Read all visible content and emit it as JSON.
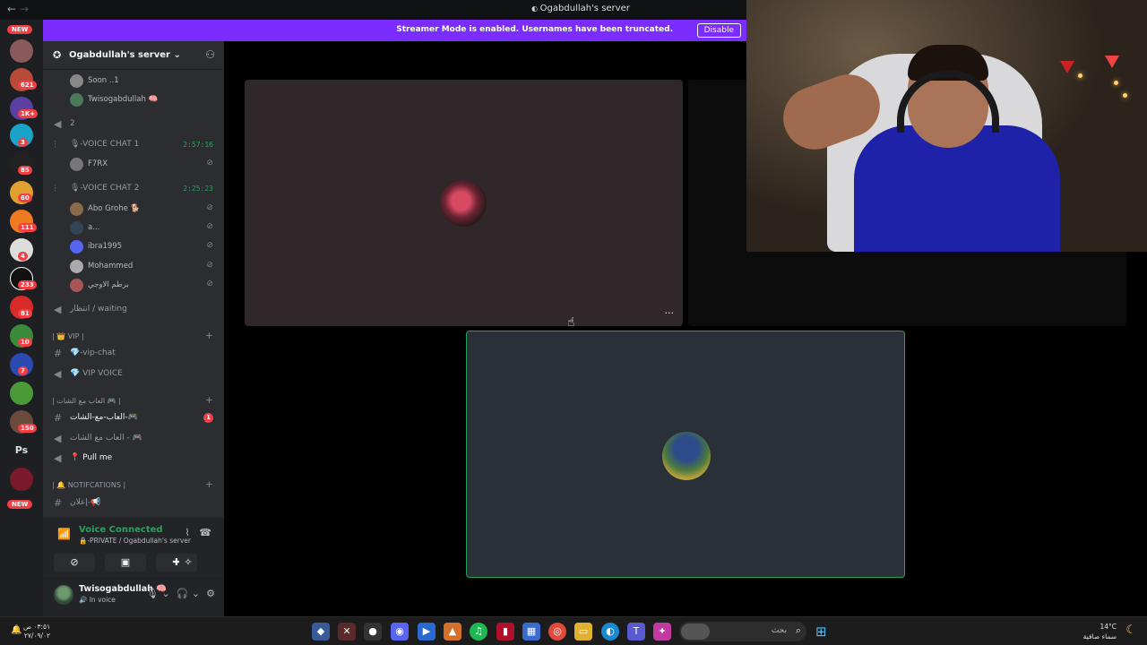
{
  "window": {
    "title": "Ogabdullah's server",
    "nav_back": "←",
    "nav_fwd": "→"
  },
  "banner": {
    "message": "Streamer Mode is enabled. Usernames have been truncated.",
    "button": "Disable",
    "color": "#7b2cff"
  },
  "server_rail": {
    "new_top": "NEW",
    "new_bottom": "NEW",
    "ps_label": "Ps",
    "badges": [
      "621",
      "1K+",
      "3",
      "85",
      "60",
      "111",
      "4",
      "233",
      "81",
      "10",
      "7",
      "150"
    ]
  },
  "sidebar": {
    "server_name": "Ogabdullah's server",
    "chevron": "⌄",
    "items": [
      {
        "kind": "user",
        "label": "Soon ..1"
      },
      {
        "kind": "user-hi",
        "label": "Twisogabdullah 🧠"
      },
      {
        "kind": "voice",
        "label": "2"
      },
      {
        "kind": "voice-live",
        "label": "🎙-VOICE CHAT 1",
        "timer": "2:57:16"
      },
      {
        "kind": "user",
        "label": "F7RX"
      },
      {
        "kind": "voice-live",
        "label": "🎙-VOICE CHAT 2",
        "timer": "2:25:23"
      },
      {
        "kind": "user",
        "label": "Abo Grohe 🐕"
      },
      {
        "kind": "user",
        "label": "a..."
      },
      {
        "kind": "user",
        "label": "ibra1995"
      },
      {
        "kind": "user",
        "label": "Mohammed"
      },
      {
        "kind": "user",
        "label": "برطم الاوجي"
      },
      {
        "kind": "voice",
        "label": "انتظار / waiting"
      },
      {
        "kind": "category",
        "label": "| 👑 VIP |"
      },
      {
        "kind": "text",
        "label": "💎-vip-chat"
      },
      {
        "kind": "voice",
        "label": "💎 VIP VOICE"
      },
      {
        "kind": "category",
        "label": "| العاب مع الشات 🎮 |"
      },
      {
        "kind": "text-hi",
        "label": "العاب-مع-الشات-🎮",
        "badge": "1"
      },
      {
        "kind": "voice",
        "label": "العاب مع الشات - 🎮"
      },
      {
        "kind": "voice-hi",
        "label": "📍 Pull me"
      },
      {
        "kind": "category",
        "label": "| 🔔 NOTIFCATIONS |"
      },
      {
        "kind": "text",
        "label": "إعلان-📢"
      }
    ]
  },
  "voice_panel": {
    "status": "Voice Connected",
    "channel": "🔒-PRIVATE / Ogabdullah's server"
  },
  "user_panel": {
    "name": "Twisogabdullah 🧠",
    "status": "🔊 In voice"
  },
  "stage": {
    "more_label": "···"
  },
  "taskbar": {
    "time": "٠٣:٥١ ص",
    "date": "٢٧/٠٩/٠٢",
    "search_placeholder": "بحث",
    "weather_temp": "14°C",
    "weather_desc": "سماء صافية"
  }
}
